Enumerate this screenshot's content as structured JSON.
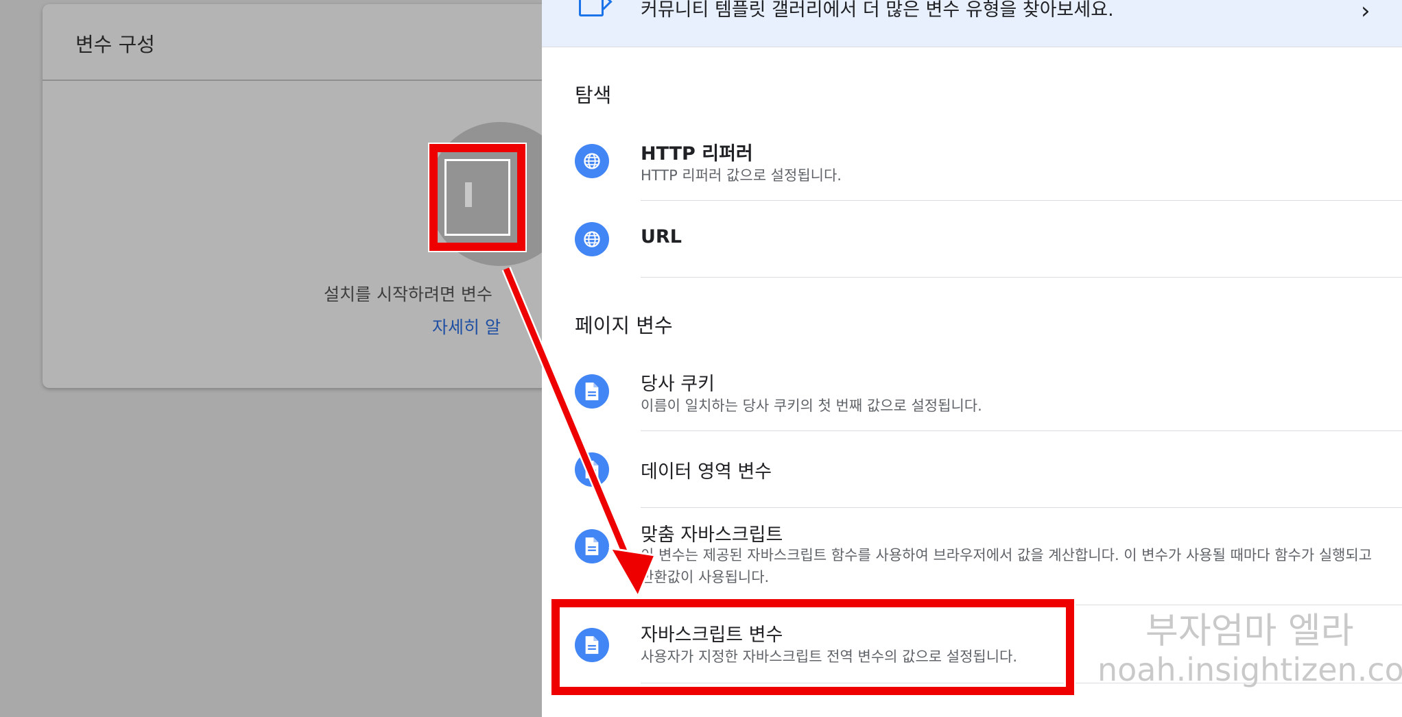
{
  "background": {
    "title": "변수 구성",
    "hint": "설치를 시작하려면 변수",
    "link": "자세히 알"
  },
  "banner": {
    "text": "커뮤니티 템플릿 갤러리에서 더 많은 변수 유형을 찾아보세요.",
    "chevron": "›"
  },
  "sections": [
    {
      "label": "탐색",
      "items": [
        {
          "title": "HTTP 리퍼러",
          "desc": "HTTP 리퍼러 값으로 설정됩니다.",
          "icon": "globe-icon"
        },
        {
          "title": "URL",
          "desc": "",
          "icon": "globe-icon"
        }
      ]
    },
    {
      "label": "페이지 변수",
      "items": [
        {
          "title": "당사 쿠키",
          "desc": "이름이 일치하는 당사 쿠키의 첫 번째 값으로 설정됩니다.",
          "icon": "document-icon"
        },
        {
          "title": "데이터 영역 변수",
          "desc": "",
          "icon": "document-icon"
        },
        {
          "title": "맞춤 자바스크립트",
          "desc": "이 변수는 제공된 자바스크립트 함수를 사용하여 브라우저에서 값을 계산합니다. 이 변수가 사용될 때마다 함수가 실행되고 반환값이 사용됩니다.",
          "icon": "document-icon"
        },
        {
          "title": "자바스크립트 변수",
          "desc": "사용자가 지정한 자바스크립트 전역 변수의 값으로 설정됩니다.",
          "icon": "document-icon"
        }
      ]
    }
  ],
  "watermark": {
    "line1": "부자엄마 엘라",
    "line2": "noah.insightizen.com"
  },
  "colors": {
    "accent": "#4285f4",
    "highlight": "#ee0000",
    "banner_bg": "#e8f0fe"
  }
}
